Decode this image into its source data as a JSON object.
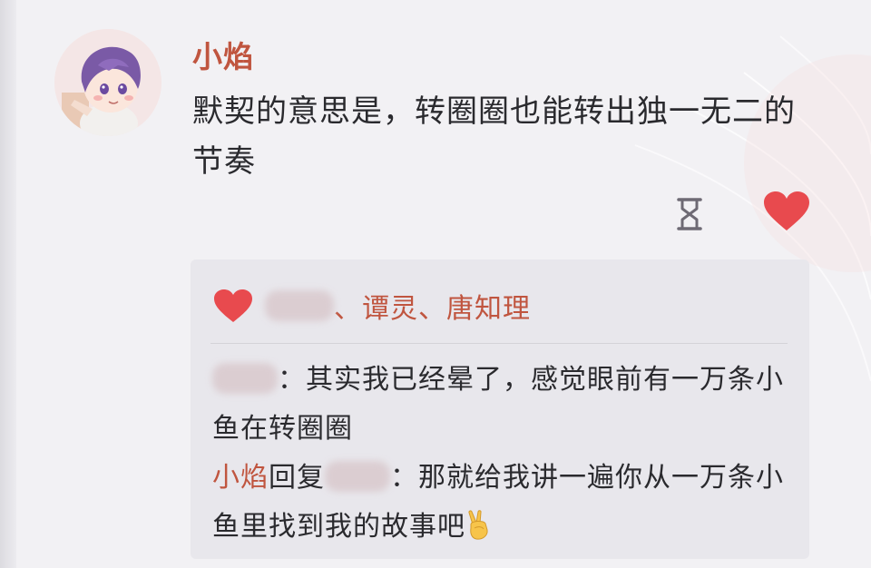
{
  "post": {
    "author": "小焰",
    "text": "默契的意思是，转圈圈也能转出独一无二的节奏"
  },
  "icons": {
    "hourglass": "hourglass-icon",
    "like": "heart-icon",
    "emoji": "victory-hand-emoji"
  },
  "likes": {
    "names_suffix": "、谭灵、唐知理"
  },
  "comments": [
    {
      "separator": "：",
      "text": "其实我已经晕了，感觉眼前有一万条小鱼在转圈圈"
    },
    {
      "replier": "小焰",
      "reply_word": "回复",
      "separator": "：",
      "text": "那就给我讲一遍你从一万条小鱼里找到我的故事吧"
    }
  ],
  "colors": {
    "accent": "#c0553f",
    "like_red": "#e84a4e",
    "text": "#2a2a2e",
    "panel_bg": "#e8e7ec"
  }
}
